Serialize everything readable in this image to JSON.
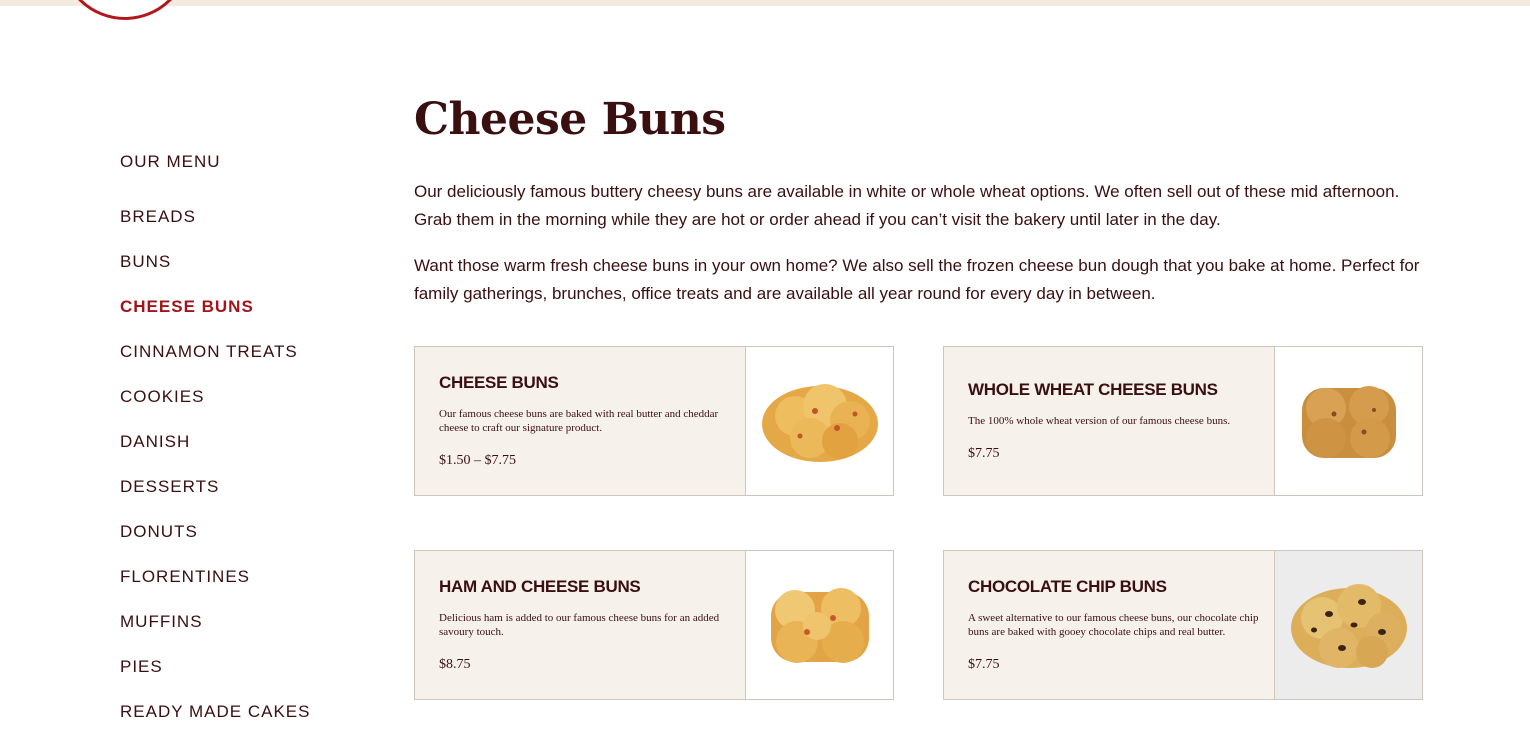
{
  "sidebar": {
    "title": "OUR MENU",
    "items": [
      {
        "label": "BREADS"
      },
      {
        "label": "BUNS"
      },
      {
        "label": "CHEESE BUNS",
        "active": true
      },
      {
        "label": "CINNAMON TREATS"
      },
      {
        "label": "COOKIES"
      },
      {
        "label": "DANISH"
      },
      {
        "label": "DESSERTS"
      },
      {
        "label": "DONUTS"
      },
      {
        "label": "FLORENTINES"
      },
      {
        "label": "MUFFINS"
      },
      {
        "label": "PIES"
      },
      {
        "label": "READY MADE CAKES"
      }
    ]
  },
  "main": {
    "title": "Cheese Buns",
    "intro": [
      "Our deliciously famous buttery cheesy buns are available in white or whole wheat options. We often sell out of these mid afternoon. Grab them in the morning while they are hot or order ahead if you can’t visit the bakery until later in the day.",
      "Want those warm fresh cheese buns in your own home? We also sell the frozen cheese bun dough that you bake at home. Perfect for family gatherings, brunches, office treats and are available all year round for every day in between."
    ],
    "products": [
      {
        "name": "CHEESE BUNS",
        "description": "Our famous cheese buns are baked with real butter and cheddar cheese to craft our signature product.",
        "price": "$1.50 – $7.75"
      },
      {
        "name": "WHOLE WHEAT CHEESE BUNS",
        "description": "The 100% whole wheat version of our famous cheese buns.",
        "price": "$7.75"
      },
      {
        "name": "HAM AND CHEESE BUNS",
        "description": "Delicious ham is added to our famous cheese buns for an added savoury touch.",
        "price": "$8.75"
      },
      {
        "name": "CHOCOLATE CHIP BUNS",
        "description": "A sweet alternative to our famous cheese buns, our chocolate chip buns are baked with gooey chocolate chips and real butter.",
        "price": "$7.75"
      }
    ]
  },
  "colors": {
    "brand_red": "#a3141a",
    "text_dark": "#3a0f10",
    "card_bg": "#f6f1eb"
  }
}
